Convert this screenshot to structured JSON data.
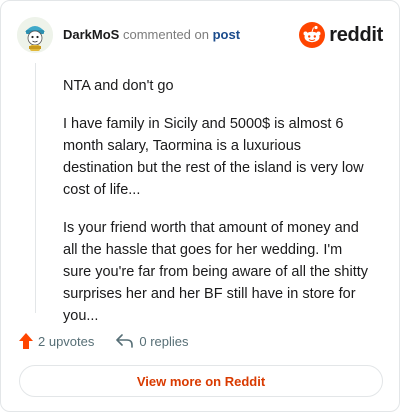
{
  "comment": {
    "author": "DarkMoS",
    "action_text": "commented on",
    "target_text": "post",
    "paragraphs": [
      "NTA and don't go",
      "I have family in Sicily and 5000$ is almost 6 month salary, Taormina is a luxurious destination but the rest of the island is very low cost of life...",
      "Is your friend worth that amount of money and all the hassle that goes for her wedding. I'm sure you're far from being aware of all the shitty surprises her and her BF still have in store for you..."
    ]
  },
  "brand": {
    "name": "reddit",
    "color": "#ff4500",
    "icon": "reddit-logo-icon"
  },
  "actions": {
    "upvotes_label": "2 upvotes",
    "replies_label": "0 replies",
    "upvote_icon": "upvote-arrow-icon",
    "reply_icon": "reply-arrow-icon"
  },
  "footer": {
    "view_more_label": "View more on Reddit"
  },
  "colors": {
    "accent": "#d93a00",
    "upvote": "#ff4500",
    "link": "#1a4b8c"
  }
}
